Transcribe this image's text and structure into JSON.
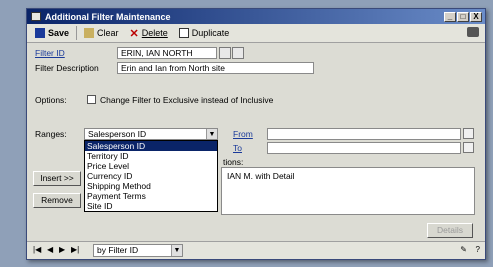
{
  "window": {
    "title": "Additional Filter Maintenance"
  },
  "titlebar_buttons": [
    "_",
    "□",
    "X"
  ],
  "toolbar": {
    "save": "Save",
    "clear": "Clear",
    "delete": "Delete",
    "duplicate": "Duplicate"
  },
  "form": {
    "filter_id_label": "Filter ID",
    "filter_id_value": "ERIN, IAN NORTH",
    "filter_desc_label": "Filter Description",
    "filter_desc_value": "Erin and Ian from North site",
    "options_label": "Options:",
    "checkbox_label": "Change Filter to Exclusive instead of Inclusive",
    "ranges_label": "Ranges:",
    "ranges_value": "Salesperson ID",
    "from_label": "From",
    "to_label": "To",
    "restrictions_label_partial": "tions:",
    "restriction_text_partial": "IAN M. with Detail"
  },
  "dropdown_options": [
    "Salesperson ID",
    "Territory ID",
    "Price Level",
    "Currency ID",
    "Shipping Method",
    "Payment Terms",
    "Site ID"
  ],
  "buttons": {
    "insert": "Insert >>",
    "remove": "Remove",
    "details": "Details"
  },
  "bottombar": {
    "browse_by": "by Filter ID"
  }
}
